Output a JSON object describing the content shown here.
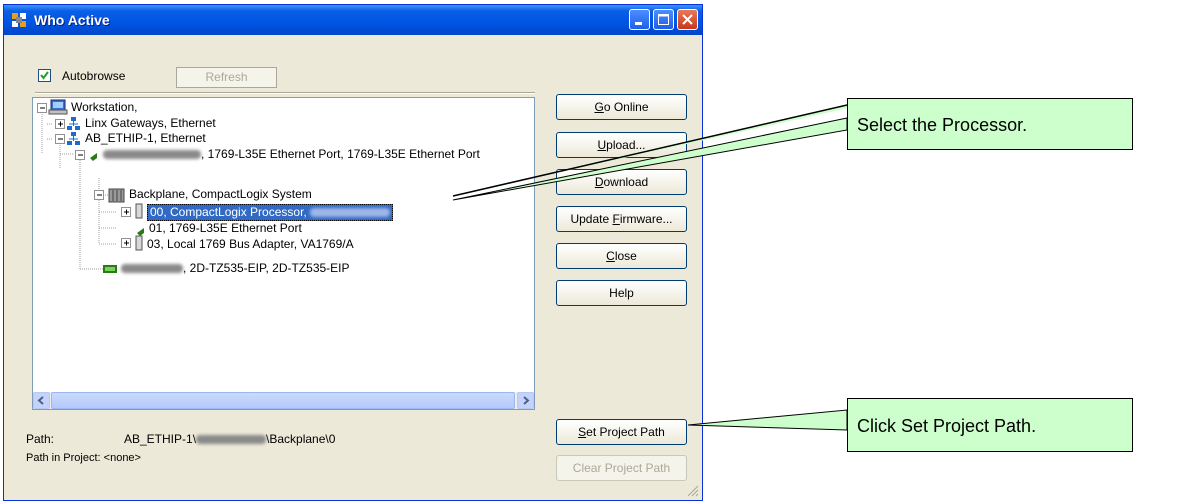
{
  "window": {
    "title": "Who Active",
    "icons": [
      "app-icon",
      "minimize-icon",
      "maximize-icon",
      "close-icon"
    ]
  },
  "autobrowse": {
    "label": "Autobrowse",
    "checked": true
  },
  "refresh_label": "Refresh",
  "tree": {
    "workstation": "Workstation,",
    "linx": "Linx Gateways, Ethernet",
    "ethip": "AB_ETHIP-1, Ethernet",
    "port_suffix": ", 1769-L35E Ethernet Port, 1769-L35E Ethernet Port",
    "backplane": "Backplane, CompactLogix System",
    "processor": "00, CompactLogix Processor,",
    "eth_port": "01, 1769-L35E Ethernet Port",
    "bus_adapter": "03, Local 1769 Bus Adapter, VA1769/A",
    "tz535_suffix": ", 2D-TZ535-EIP, 2D-TZ535-EIP"
  },
  "buttons": {
    "go_online_u": "G",
    "go_online_rest": "o Online",
    "upload_u": "U",
    "upload_rest": "pload...",
    "download_u": "D",
    "download_rest": "ownload",
    "update_pre": "Update ",
    "update_u": "F",
    "update_rest": "irmware...",
    "close_u": "C",
    "close_rest": "lose",
    "help": "Help",
    "set_path_u": "S",
    "set_path_rest": "et Project Path",
    "clear_path": "Clear Project Path"
  },
  "path": {
    "label": "Path:",
    "value_start": "AB_ETHIP-1\\",
    "value_end": "\\Backplane\\0",
    "in_project_label": "Path in Project:",
    "in_project_value": "<none>"
  },
  "callouts": {
    "select_processor": "Select the Processor.",
    "set_project_path": "Click Set Project Path."
  },
  "colors": {
    "titlebar": "#0054e3",
    "selection": "#316ac5",
    "callout_bg": "#ccffcc",
    "dialog_bg": "#ece9d8"
  }
}
